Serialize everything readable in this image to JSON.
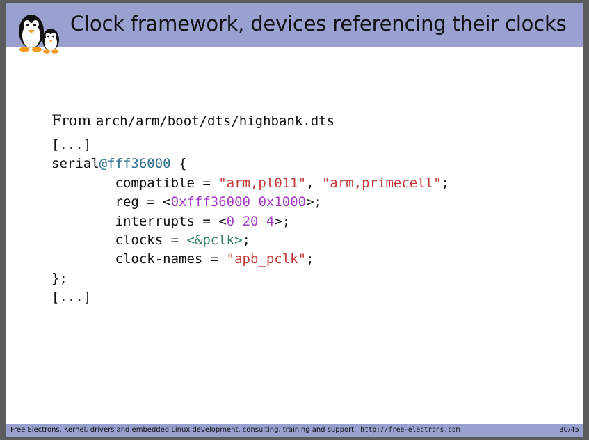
{
  "slide": {
    "title": "Clock framework, devices referencing their clocks",
    "from_label": "From",
    "from_path": "arch/arm/boot/dts/highbank.dts",
    "code": {
      "ellipsis_open": "[...]",
      "node_name": "serial",
      "node_addr": "@fff36000",
      "node_open": " {",
      "compatible_key": "        compatible = ",
      "compatible_val1": "\"arm,pl011\"",
      "compatible_sep": ", ",
      "compatible_val2": "\"arm,primecell\"",
      "compatible_end": ";",
      "reg_key": "        reg = <",
      "reg_val1": "0xfff36000",
      "reg_sep": " ",
      "reg_val2": "0x1000",
      "reg_end": ">;",
      "interrupts_key": "        interrupts = <",
      "interrupts_v1": "0",
      "interrupts_v2": "20",
      "interrupts_v3": "4",
      "interrupts_end": ">;",
      "clocks_key": "        clocks = ",
      "clocks_val": "<&pclk>",
      "clocks_end": ";",
      "clocknames_key": "        clock-names = ",
      "clocknames_val": "\"apb_pclk\"",
      "clocknames_end": ";",
      "node_close": "};",
      "ellipsis_close": "[...]"
    }
  },
  "footer": {
    "text": "Free Electrons. Kernel, drivers and embedded Linux development, consulting, training and support.",
    "url": "http://free-electrons.com",
    "page": "30/45"
  },
  "colors": {
    "header_bg": "#9aa0cf",
    "address": "#2b6f8a",
    "string": "#c33838",
    "number": "#a23ac2",
    "reference": "#2f7f62"
  },
  "icons": {
    "logo": "penguin-logo-icon"
  }
}
